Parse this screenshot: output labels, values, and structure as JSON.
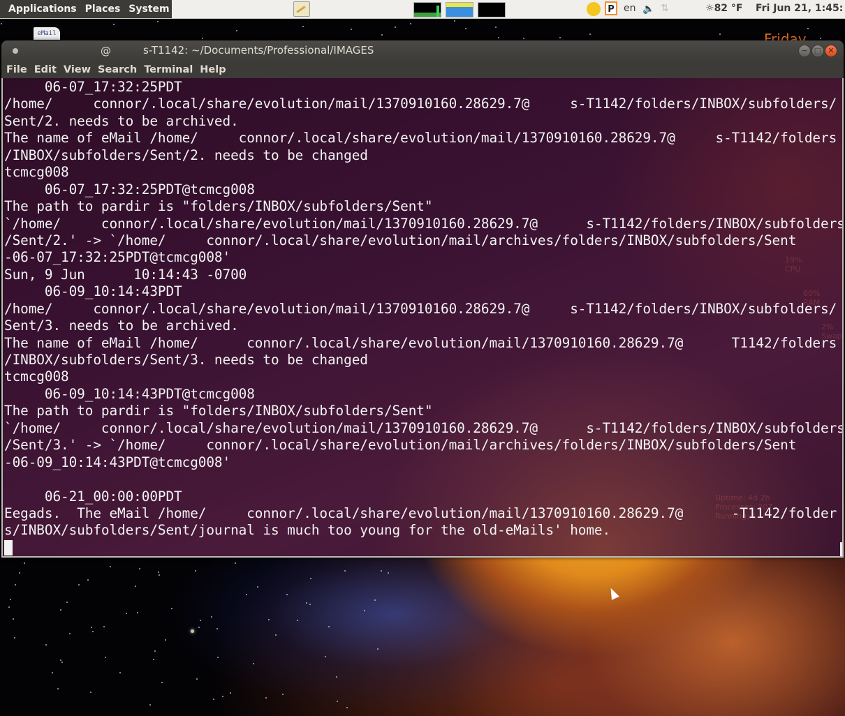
{
  "panel": {
    "menus": [
      "Applications",
      "Places",
      "System"
    ],
    "tray": {
      "keyboard_layout": "en",
      "weather": "82 °F",
      "clock": "Fri Jun 21,  1:45:"
    }
  },
  "desktop": {
    "icon_label": "eMail",
    "widget_day": "Friday",
    "conky": {
      "cpu": "19%",
      "cpu_label": "CPU",
      "ram": "60%",
      "ram_label": "RAM",
      "swap": "2%",
      "swap_label": "Swap",
      "uptime": "Uptime: 4d 2h",
      "processes": "Processes: 207",
      "running": "Running: 1"
    }
  },
  "window": {
    "title_at": "@",
    "title": "s-T1142: ~/Documents/Professional/IMAGES",
    "menu": [
      "File",
      "Edit",
      "View",
      "Search",
      "Terminal",
      "Help"
    ]
  },
  "terminal": {
    "lines": [
      "     06-07_17:32:25PDT",
      "/home/     connor/.local/share/evolution/mail/1370910160.28629.7@     s-T1142/folders/INBOX/subfolders/",
      "Sent/2. needs to be archived.",
      "The name of eMail /home/     connor/.local/share/evolution/mail/1370910160.28629.7@     s-T1142/folders",
      "/INBOX/subfolders/Sent/2. needs to be changed",
      "tcmcg008",
      "     06-07_17:32:25PDT@tcmcg008",
      "The path to pardir is \"folders/INBOX/subfolders/Sent\"",
      "`/home/     connor/.local/share/evolution/mail/1370910160.28629.7@      s-T1142/folders/INBOX/subfolders",
      "/Sent/2.' -> `/home/     connor/.local/share/evolution/mail/archives/folders/INBOX/subfolders/Sent",
      "-06-07_17:32:25PDT@tcmcg008'",
      "Sun, 9 Jun      10:14:43 -0700",
      "     06-09_10:14:43PDT",
      "/home/     connor/.local/share/evolution/mail/1370910160.28629.7@     s-T1142/folders/INBOX/subfolders/",
      "Sent/3. needs to be archived.",
      "The name of eMail /home/      connor/.local/share/evolution/mail/1370910160.28629.7@      T1142/folders",
      "/INBOX/subfolders/Sent/3. needs to be changed",
      "tcmcg008",
      "     06-09_10:14:43PDT@tcmcg008",
      "The path to pardir is \"folders/INBOX/subfolders/Sent\"",
      "`/home/     connor/.local/share/evolution/mail/1370910160.28629.7@      s-T1142/folders/INBOX/subfolders",
      "/Sent/3.' -> `/home/     connor/.local/share/evolution/mail/archives/folders/INBOX/subfolders/Sent",
      "-06-09_10:14:43PDT@tcmcg008'",
      "",
      "     06-21_00:00:00PDT",
      "Eegads.  The eMail /home/     connor/.local/share/evolution/mail/1370910160.28629.7@      -T1142/folder",
      "s/INBOX/subfolders/Sent/journal is much too young for the old-eMails' home."
    ]
  }
}
